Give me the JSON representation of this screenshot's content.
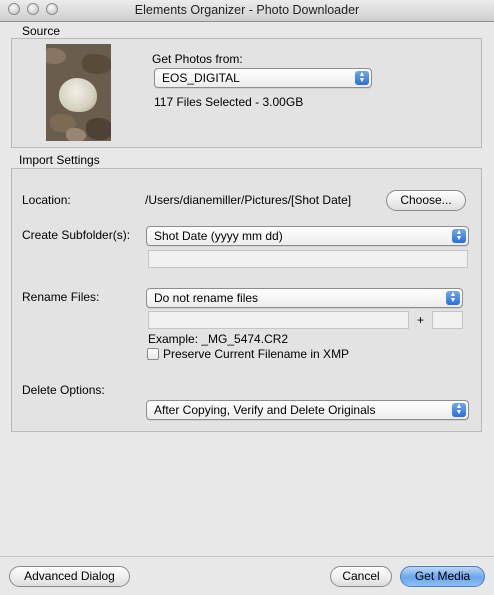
{
  "window": {
    "title": "Elements Organizer - Photo Downloader"
  },
  "source": {
    "header": "Source",
    "get_photos_label": "Get Photos from:",
    "device": "EOS_DIGITAL",
    "files_selected": "117 Files Selected - 3.00GB",
    "thumbnail_icon": "photo-thumbnail"
  },
  "import_settings": {
    "header": "Import Settings",
    "location_label": "Location:",
    "location_path": "/Users/dianemiller/Pictures/[Shot Date]",
    "choose_button": "Choose...",
    "subfolder_label": "Create Subfolder(s):",
    "subfolder_value": "Shot Date (yyyy mm dd)",
    "subfolder_custom_value": "",
    "rename_label": "Rename Files:",
    "rename_value": "Do not rename files",
    "rename_name_value": "",
    "rename_plus": "+",
    "rename_number_value": "",
    "example_text": "Example:  _MG_5474.CR2",
    "preserve_checkbox_label": "Preserve Current Filename in XMP",
    "preserve_checked": false,
    "delete_label": "Delete Options:",
    "delete_value": "After Copying, Verify and Delete Originals"
  },
  "footer": {
    "advanced_button": "Advanced Dialog",
    "cancel_button": "Cancel",
    "get_media_button": "Get Media"
  },
  "colors": {
    "primary_button": "#6aa5ec",
    "popup_arrows": "#2c6fd4",
    "window_background": "#e8e8e8"
  }
}
